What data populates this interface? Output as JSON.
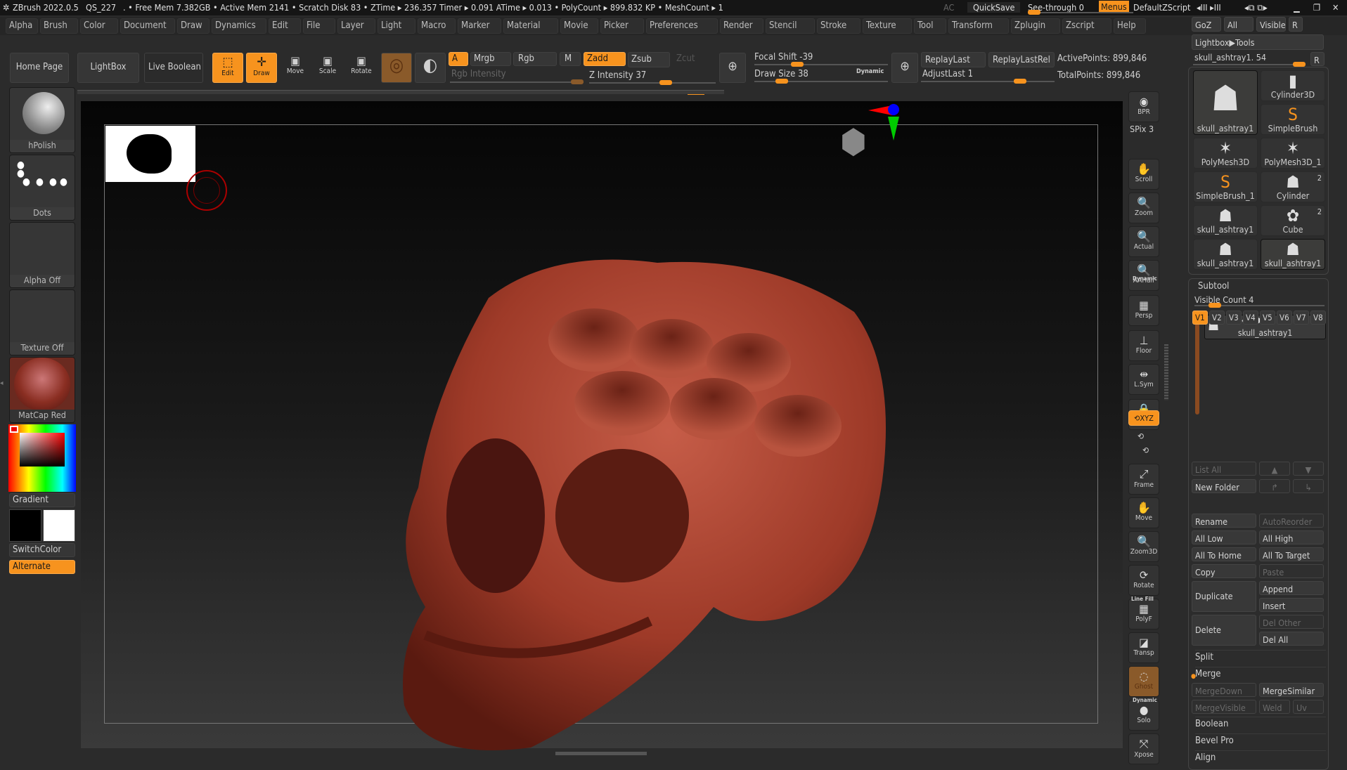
{
  "titlebar": {
    "app": "ZBrush 2022.0.5",
    "doc": "QS_227",
    "stats": ". • Free Mem 7.382GB • Active Mem 2141 • Scratch Disk 83 •  ZTime ▸ 236.357 Timer ▸ 0.091 ATime ▸ 0.013 • PolyCount ▸ 899.832 KP  • MeshCount ▸ 1",
    "ac": "AC",
    "quicksave": "QuickSave",
    "seethrough": "See-through  0",
    "menus": "Menus",
    "script": "DefaultZScript"
  },
  "menus": [
    "Alpha",
    "Brush",
    "Color",
    "Document",
    "Draw",
    "Dynamics",
    "Edit",
    "File",
    "Layer",
    "Light",
    "Macro",
    "Marker",
    "Material",
    "Movie",
    "Picker",
    "Preferences",
    "Render",
    "Stencil",
    "Stroke",
    "Texture",
    "Tool",
    "Transform",
    "Zplugin",
    "Zscript",
    "Help"
  ],
  "toolbar": {
    "home": "Home Page",
    "lightbox": "LightBox",
    "liveboolean": "Live Boolean",
    "edit": "Edit",
    "draw": "Draw",
    "move": "Move",
    "scale": "Scale",
    "rotate": "Rotate",
    "a": "A",
    "mrgb": "Mrgb",
    "rgb": "Rgb",
    "m": "M",
    "zadd": "Zadd",
    "zsub": "Zsub",
    "zcut": "Zcut",
    "rgb_intensity": "Rgb Intensity",
    "z_intensity": "Z Intensity 37",
    "focal_shift": "Focal Shift -39",
    "draw_size": "Draw Size 38",
    "dynamic": "Dynamic",
    "replaylast": "ReplayLast",
    "replaylastrel": "ReplayLastRel",
    "adjustlast": "AdjustLast 1",
    "activepoints": "ActivePoints: 899,846",
    "totalpoints": "TotalPoints: 899,846",
    "z_intensity_value": 37,
    "focal_shift_value": -39,
    "draw_size_value": 38
  },
  "left": {
    "brush": "hPolish",
    "stroke": "Dots",
    "alpha": "Alpha Off",
    "texture": "Texture Off",
    "material": "MatCap Red Wax",
    "gradient": "Gradient",
    "switchcolor": "SwitchColor",
    "alternate": "Alternate"
  },
  "shelf": [
    "BPR",
    "SPix 3",
    "Scroll",
    "Zoom",
    "Actual",
    "AAHalf",
    "Persp",
    "Floor",
    "L.Sym",
    "",
    "XYZ",
    "Frame",
    "Move",
    "Zoom3D",
    "Rotate",
    "PolyF",
    "Transp",
    "Ghost",
    "Solo",
    "Xpose"
  ],
  "shelf_extra": {
    "dynamic": "Dynamic",
    "linefill": "Line Fill"
  },
  "right": {
    "goz": "GoZ",
    "all": "All",
    "visible": "Visible",
    "r": "R",
    "lightbox_tools": "Lightbox▶Tools",
    "current_tool": "skull_ashtray1. 54",
    "tools": [
      {
        "name": "skull_ashtray1"
      },
      {
        "name": "Cylinder3D"
      },
      {
        "name": "SimpleBrush"
      },
      {
        "name": "PolyMesh3D"
      },
      {
        "name": "PolyMesh3D_1"
      },
      {
        "name": "SimpleBrush_1"
      },
      {
        "name": "Cylinder",
        "badge": "2"
      },
      {
        "name": "skull_ashtray1"
      },
      {
        "name": "Cube",
        "badge": "2"
      },
      {
        "name": "skull_ashtray1"
      },
      {
        "name": "skull_ashtray1"
      }
    ],
    "subtool": "Subtool",
    "visible_count": "Visible Count 4",
    "vtabs": [
      "V1",
      "V2",
      "V3",
      "V4",
      "V5",
      "V6",
      "V7",
      "V8"
    ],
    "subtool_item": "skull_ashtray1",
    "listall": "List All",
    "newfolder": "New Folder",
    "rename": "Rename",
    "autoreorder": "AutoReorder",
    "alllow": "All Low",
    "allhigh": "All High",
    "alltohome": "All To Home",
    "alltotarget": "All To Target",
    "copy": "Copy",
    "paste": "Paste",
    "duplicate": "Duplicate",
    "append": "Append",
    "insert": "Insert",
    "delete": "Delete",
    "delother": "Del Other",
    "delall": "Del All",
    "split": "Split",
    "merge": "Merge",
    "mergedown": "MergeDown",
    "mergesimilar": "MergeSimilar",
    "mergevisible": "MergeVisible",
    "weld": "Weld",
    "uv": "Uv",
    "boolean": "Boolean",
    "bevelpro": "Bevel Pro",
    "align": "Align"
  }
}
